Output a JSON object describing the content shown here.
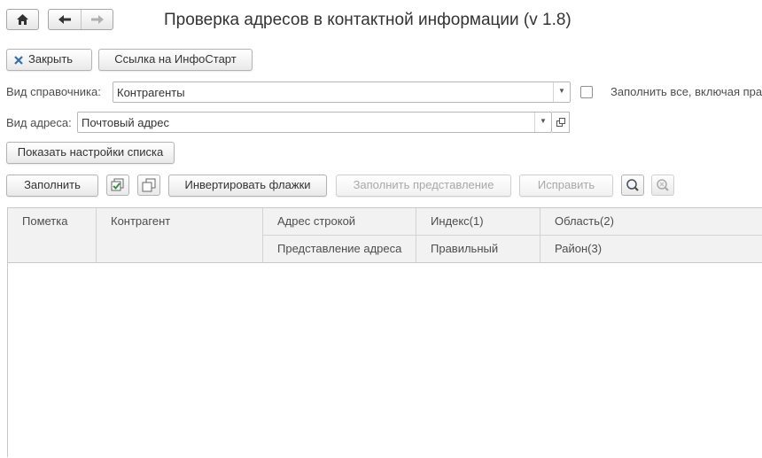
{
  "title": "Проверка адресов в контактной информации (v 1.8)",
  "toolbar": {
    "close_label": "Закрыть",
    "infostart_label": "Ссылка на ИнфоСтарт"
  },
  "form": {
    "directory_label": "Вид справочника:",
    "directory_value": "Контрагенты",
    "fill_all_label": "Заполнить все, включая пра",
    "address_type_label": "Вид адреса:",
    "address_type_value": "Почтовый адрес",
    "show_settings_label": "Показать настройки списка"
  },
  "actions": {
    "fill_label": "Заполнить",
    "invert_label": "Инвертировать флажки",
    "fill_repr_label": "Заполнить представление",
    "fix_label": "Исправить"
  },
  "table": {
    "columns": {
      "mark": "Пометка",
      "counterparty": "Контрагент",
      "address_string": "Адрес строкой",
      "address_repr": "Представление адреса",
      "index": "Индекс(1)",
      "correct": "Правильный",
      "region": "Область(2)",
      "district": "Район(3)"
    },
    "rows": []
  },
  "icons": {
    "home": "home-icon",
    "back": "arrow-left-icon",
    "forward": "arrow-right-icon",
    "close": "close-icon",
    "check_all": "check-all-icon",
    "uncheck_all": "uncheck-all-icon",
    "search": "search-icon",
    "search_cancel": "search-cancel-icon"
  }
}
